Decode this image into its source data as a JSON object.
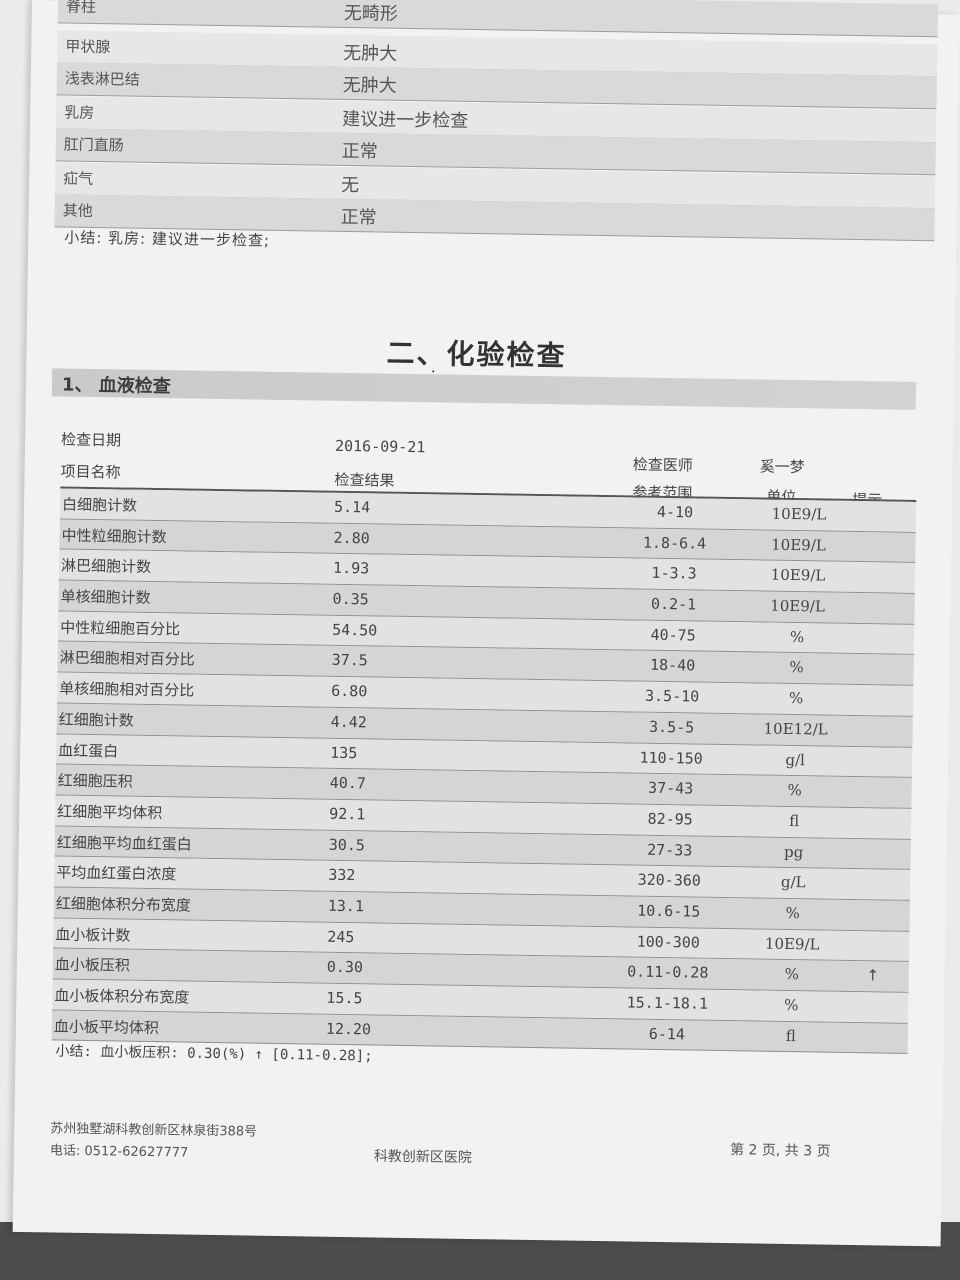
{
  "exam_rows": [
    {
      "name": "脊柱",
      "result": "无畸形"
    },
    {
      "name": "甲状腺",
      "result": "无肿大"
    },
    {
      "name": "浅表淋巴结",
      "result": "无肿大"
    },
    {
      "name": "乳房",
      "result": "建议进一步检查"
    },
    {
      "name": "肛门直肠",
      "result": "正常"
    },
    {
      "name": "疝气",
      "result": "无"
    },
    {
      "name": "其他",
      "result": "正常"
    }
  ],
  "exam_summary": "小结: 乳房: 建议进一步检查;",
  "section_title": "二、化验检查",
  "subsection_title": "1、 血液检查",
  "header": {
    "date_label": "检查日期",
    "date_value": "2016-09-21",
    "doctor_label": "检查医师",
    "doctor_value": "奚一梦",
    "item_label": "项目名称",
    "result_label": "检查结果",
    "ref_label": "参考范围",
    "unit_label": "单位",
    "flag_label": "提示"
  },
  "lab_rows": [
    {
      "name": "白细胞计数",
      "value": "5.14",
      "ref": "4-10",
      "unit": "10E9/L",
      "flag": ""
    },
    {
      "name": "中性粒细胞计数",
      "value": "2.80",
      "ref": "1.8-6.4",
      "unit": "10E9/L",
      "flag": ""
    },
    {
      "name": "淋巴细胞计数",
      "value": "1.93",
      "ref": "1-3.3",
      "unit": "10E9/L",
      "flag": ""
    },
    {
      "name": "单核细胞计数",
      "value": "0.35",
      "ref": "0.2-1",
      "unit": "10E9/L",
      "flag": ""
    },
    {
      "name": "中性粒细胞百分比",
      "value": "54.50",
      "ref": "40-75",
      "unit": "%",
      "flag": ""
    },
    {
      "name": "淋巴细胞相对百分比",
      "value": "37.5",
      "ref": "18-40",
      "unit": "%",
      "flag": ""
    },
    {
      "name": "单核细胞相对百分比",
      "value": "6.80",
      "ref": "3.5-10",
      "unit": "%",
      "flag": ""
    },
    {
      "name": "红细胞计数",
      "value": "4.42",
      "ref": "3.5-5",
      "unit": "10E12/L",
      "flag": ""
    },
    {
      "name": "血红蛋白",
      "value": "135",
      "ref": "110-150",
      "unit": "g/l",
      "flag": ""
    },
    {
      "name": "红细胞压积",
      "value": "40.7",
      "ref": "37-43",
      "unit": "%",
      "flag": ""
    },
    {
      "name": "红细胞平均体积",
      "value": "92.1",
      "ref": "82-95",
      "unit": "fl",
      "flag": ""
    },
    {
      "name": "红细胞平均血红蛋白",
      "value": "30.5",
      "ref": "27-33",
      "unit": "pg",
      "flag": ""
    },
    {
      "name": "平均血红蛋白浓度",
      "value": "332",
      "ref": "320-360",
      "unit": "g/L",
      "flag": ""
    },
    {
      "name": "红细胞体积分布宽度",
      "value": "13.1",
      "ref": "10.6-15",
      "unit": "%",
      "flag": ""
    },
    {
      "name": "血小板计数",
      "value": "245",
      "ref": "100-300",
      "unit": "10E9/L",
      "flag": ""
    },
    {
      "name": "血小板压积",
      "value": "0.30",
      "ref": "0.11-0.28",
      "unit": "%",
      "flag": "↑"
    },
    {
      "name": "血小板体积分布宽度",
      "value": "15.5",
      "ref": "15.1-18.1",
      "unit": "%",
      "flag": ""
    },
    {
      "name": "血小板平均体积",
      "value": "12.20",
      "ref": "6-14",
      "unit": "fl",
      "flag": ""
    }
  ],
  "lab_summary": "小结: 血小板压积: 0.30(%)  ↑   [0.11-0.28];",
  "footer": {
    "address": "苏州独墅湖科教创新区林泉街388号",
    "phone": "电话: 0512-62627777",
    "hospital": "科教创新区医院",
    "page": "第 2 页, 共 3 页"
  }
}
